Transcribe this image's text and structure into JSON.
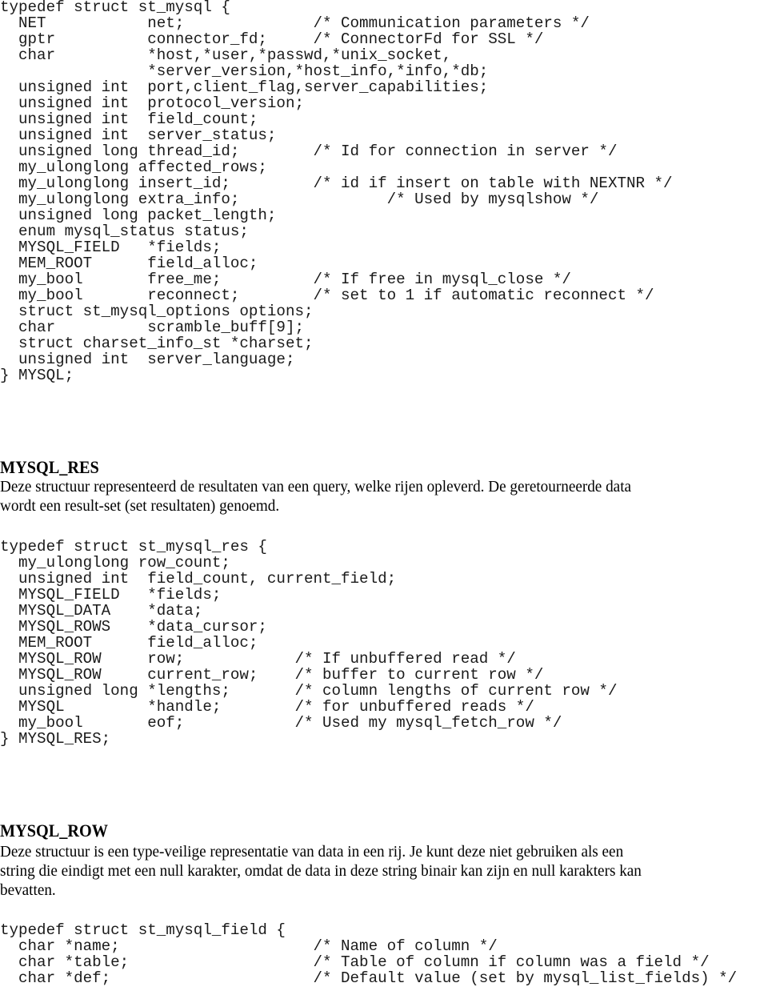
{
  "code_mysql": {
    "lines": [
      "typedef struct st_mysql {",
      "  NET           net;              /* Communication parameters */",
      "  gptr          connector_fd;     /* ConnectorFd for SSL */",
      "  char          *host,*user,*passwd,*unix_socket,",
      "                *server_version,*host_info,*info,*db;",
      "  unsigned int  port,client_flag,server_capabilities;",
      "  unsigned int  protocol_version;",
      "  unsigned int  field_count;",
      "  unsigned int  server_status;",
      "  unsigned long thread_id;        /* Id for connection in server */",
      "  my_ulonglong affected_rows;",
      "  my_ulonglong insert_id;         /* id if insert on table with NEXTNR */",
      "  my_ulonglong extra_info;                /* Used by mysqlshow */",
      "  unsigned long packet_length;",
      "  enum mysql_status status;",
      "  MYSQL_FIELD   *fields;",
      "  MEM_ROOT      field_alloc;",
      "  my_bool       free_me;          /* If free in mysql_close */",
      "  my_bool       reconnect;        /* set to 1 if automatic reconnect */",
      "  struct st_mysql_options options;",
      "  char          scramble_buff[9];",
      "  struct charset_info_st *charset;",
      "  unsigned int  server_language;",
      "} MYSQL;"
    ]
  },
  "section_res": {
    "heading": "MYSQL_RES",
    "paragraph_lines": [
      "Deze structuur representeerd de resultaten van een query, welke rijen opleverd. De geretourneerde data",
      "wordt een result-set (set resultaten) genoemd."
    ]
  },
  "code_mysql_res": {
    "lines": [
      "typedef struct st_mysql_res {",
      "  my_ulonglong row_count;",
      "  unsigned int  field_count, current_field;",
      "  MYSQL_FIELD   *fields;",
      "  MYSQL_DATA    *data;",
      "  MYSQL_ROWS    *data_cursor;",
      "  MEM_ROOT      field_alloc;",
      "  MYSQL_ROW     row;            /* If unbuffered read */",
      "  MYSQL_ROW     current_row;    /* buffer to current row */",
      "  unsigned long *lengths;       /* column lengths of current row */",
      "  MYSQL         *handle;        /* for unbuffered reads */",
      "  my_bool       eof;            /* Used my mysql_fetch_row */",
      "} MYSQL_RES;"
    ]
  },
  "section_row": {
    "heading": "MYSQL_ROW",
    "paragraph_lines": [
      "Deze structuur is een type-veilige representatie van data in een rij. Je kunt deze niet gebruiken als een",
      "string die eindigt met een null karakter, omdat de data in deze string binair kan zijn en null karakters kan",
      "bevatten."
    ]
  },
  "code_mysql_field": {
    "lines": [
      "typedef struct st_mysql_field {",
      "  char *name;                     /* Name of column */",
      "  char *table;                    /* Table of column if column was a field */",
      "  char *def;                      /* Default value (set by mysql_list_fields) */"
    ]
  }
}
